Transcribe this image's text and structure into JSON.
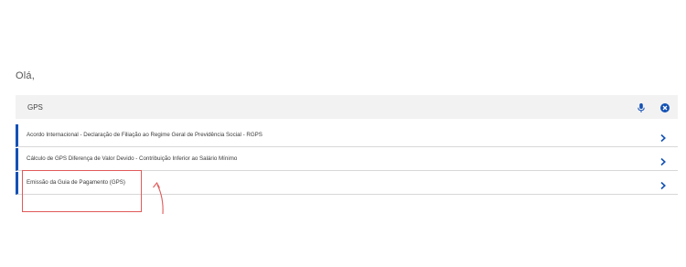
{
  "greeting": "Olá,",
  "search": {
    "value": "GPS",
    "mic_icon": "microphone-icon",
    "clear_icon": "close-circle-icon"
  },
  "results": [
    {
      "label": "Acordo Internacional - Declaração de Filiação ao Regime Geral de Previdência Social - RGPS",
      "icon": "chevron-right-icon"
    },
    {
      "label": "Cálculo de GPS Diferença de Valor Devido - Contribuição Inferior ao Salário Mínimo",
      "icon": "chevron-right-icon"
    },
    {
      "label": "Emissão da Guia de Pagamento (GPS)",
      "icon": "chevron-right-icon"
    }
  ],
  "colors": {
    "accent": "#1351b4",
    "annotation": "#e05a5a",
    "search_bg": "#f2f2f2"
  }
}
